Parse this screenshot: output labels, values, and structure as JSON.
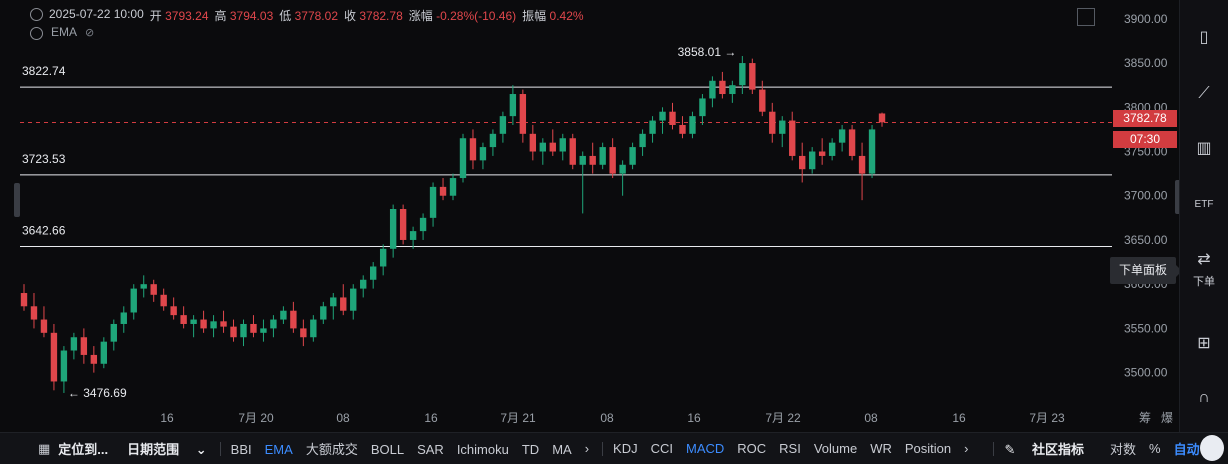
{
  "header": {
    "datetime": "2025-07-22 10:00",
    "open_label": "开",
    "open": "3793.24",
    "high_label": "高",
    "high": "3794.03",
    "low_label": "低",
    "low": "3778.02",
    "close_label": "收",
    "close": "3782.78",
    "change_label": "涨幅",
    "change": "-0.28%(-10.46)",
    "amplitude_label": "振幅",
    "amplitude": "0.42%",
    "indicator": "EMA"
  },
  "levels": [
    {
      "label": "3822.74",
      "value": 3822.74
    },
    {
      "label": "3723.53",
      "value": 3723.53
    },
    {
      "label": "3642.66",
      "value": 3642.66
    }
  ],
  "annotations": {
    "high_mark": "3858.01",
    "low_mark": "3476.69"
  },
  "price_axis": [
    "3900.00",
    "3850.00",
    "3800.00",
    "3750.00",
    "3700.00",
    "3650.00",
    "3600.00",
    "3550.00",
    "3500.00"
  ],
  "current_price": "3782.78",
  "countdown": "07:30",
  "time_axis": [
    "16",
    "7月 20",
    "08",
    "16",
    "7月 21",
    "08",
    "16",
    "7月 22",
    "08",
    "16",
    "7月 23"
  ],
  "time_axis_right": [
    "筹",
    "爆"
  ],
  "order_panel": "下单面板",
  "order_label": "下单",
  "bottom": {
    "goto": "定位到...",
    "date_range": "日期范围",
    "indicators_main": [
      "BBI",
      "EMA",
      "大额成交",
      "BOLL",
      "SAR",
      "Ichimoku",
      "TD",
      "MA"
    ],
    "indicators_sub": [
      "KDJ",
      "CCI",
      "MACD",
      "ROC",
      "RSI",
      "Volume",
      "WR",
      "Position"
    ],
    "community": "社区指标",
    "log": "对数",
    "percent": "%",
    "auto": "自动"
  },
  "colors": {
    "up": "#1fa67a",
    "down": "#e0474c",
    "accent": "#3c8cff",
    "price_tag": "#d23c40"
  },
  "chart_data": {
    "type": "candlestick",
    "ylim": [
      3460,
      3910
    ],
    "candles": [
      {
        "o": 3590,
        "h": 3600,
        "l": 3570,
        "c": 3575
      },
      {
        "o": 3575,
        "h": 3590,
        "l": 3550,
        "c": 3560
      },
      {
        "o": 3560,
        "h": 3575,
        "l": 3540,
        "c": 3545
      },
      {
        "o": 3545,
        "h": 3555,
        "l": 3480,
        "c": 3490
      },
      {
        "o": 3490,
        "h": 3530,
        "l": 3477,
        "c": 3525
      },
      {
        "o": 3525,
        "h": 3545,
        "l": 3515,
        "c": 3540
      },
      {
        "o": 3540,
        "h": 3550,
        "l": 3510,
        "c": 3520
      },
      {
        "o": 3520,
        "h": 3530,
        "l": 3500,
        "c": 3510
      },
      {
        "o": 3510,
        "h": 3540,
        "l": 3505,
        "c": 3535
      },
      {
        "o": 3535,
        "h": 3560,
        "l": 3525,
        "c": 3555
      },
      {
        "o": 3555,
        "h": 3575,
        "l": 3545,
        "c": 3568
      },
      {
        "o": 3568,
        "h": 3600,
        "l": 3560,
        "c": 3595
      },
      {
        "o": 3595,
        "h": 3610,
        "l": 3585,
        "c": 3600
      },
      {
        "o": 3600,
        "h": 3605,
        "l": 3580,
        "c": 3588
      },
      {
        "o": 3588,
        "h": 3595,
        "l": 3570,
        "c": 3575
      },
      {
        "o": 3575,
        "h": 3585,
        "l": 3560,
        "c": 3565
      },
      {
        "o": 3565,
        "h": 3575,
        "l": 3550,
        "c": 3555
      },
      {
        "o": 3555,
        "h": 3565,
        "l": 3540,
        "c": 3560
      },
      {
        "o": 3560,
        "h": 3570,
        "l": 3545,
        "c": 3550
      },
      {
        "o": 3550,
        "h": 3565,
        "l": 3540,
        "c": 3558
      },
      {
        "o": 3558,
        "h": 3570,
        "l": 3545,
        "c": 3552
      },
      {
        "o": 3552,
        "h": 3560,
        "l": 3535,
        "c": 3540
      },
      {
        "o": 3540,
        "h": 3560,
        "l": 3530,
        "c": 3555
      },
      {
        "o": 3555,
        "h": 3565,
        "l": 3540,
        "c": 3545
      },
      {
        "o": 3545,
        "h": 3560,
        "l": 3535,
        "c": 3550
      },
      {
        "o": 3550,
        "h": 3565,
        "l": 3540,
        "c": 3560
      },
      {
        "o": 3560,
        "h": 3575,
        "l": 3555,
        "c": 3570
      },
      {
        "o": 3570,
        "h": 3580,
        "l": 3545,
        "c": 3550
      },
      {
        "o": 3550,
        "h": 3560,
        "l": 3530,
        "c": 3540
      },
      {
        "o": 3540,
        "h": 3565,
        "l": 3535,
        "c": 3560
      },
      {
        "o": 3560,
        "h": 3580,
        "l": 3555,
        "c": 3575
      },
      {
        "o": 3575,
        "h": 3590,
        "l": 3560,
        "c": 3585
      },
      {
        "o": 3585,
        "h": 3600,
        "l": 3565,
        "c": 3570
      },
      {
        "o": 3570,
        "h": 3600,
        "l": 3560,
        "c": 3595
      },
      {
        "o": 3595,
        "h": 3610,
        "l": 3585,
        "c": 3605
      },
      {
        "o": 3605,
        "h": 3625,
        "l": 3595,
        "c": 3620
      },
      {
        "o": 3620,
        "h": 3645,
        "l": 3610,
        "c": 3640
      },
      {
        "o": 3640,
        "h": 3690,
        "l": 3630,
        "c": 3685
      },
      {
        "o": 3685,
        "h": 3690,
        "l": 3645,
        "c": 3650
      },
      {
        "o": 3650,
        "h": 3665,
        "l": 3640,
        "c": 3660
      },
      {
        "o": 3660,
        "h": 3680,
        "l": 3650,
        "c": 3675
      },
      {
        "o": 3675,
        "h": 3715,
        "l": 3665,
        "c": 3710
      },
      {
        "o": 3710,
        "h": 3720,
        "l": 3695,
        "c": 3700
      },
      {
        "o": 3700,
        "h": 3725,
        "l": 3695,
        "c": 3720
      },
      {
        "o": 3720,
        "h": 3770,
        "l": 3715,
        "c": 3765
      },
      {
        "o": 3765,
        "h": 3775,
        "l": 3730,
        "c": 3740
      },
      {
        "o": 3740,
        "h": 3760,
        "l": 3730,
        "c": 3755
      },
      {
        "o": 3755,
        "h": 3775,
        "l": 3745,
        "c": 3770
      },
      {
        "o": 3770,
        "h": 3795,
        "l": 3760,
        "c": 3790
      },
      {
        "o": 3790,
        "h": 3825,
        "l": 3780,
        "c": 3815
      },
      {
        "o": 3815,
        "h": 3820,
        "l": 3760,
        "c": 3770
      },
      {
        "o": 3770,
        "h": 3780,
        "l": 3740,
        "c": 3750
      },
      {
        "o": 3750,
        "h": 3765,
        "l": 3735,
        "c": 3760
      },
      {
        "o": 3760,
        "h": 3775,
        "l": 3745,
        "c": 3750
      },
      {
        "o": 3750,
        "h": 3770,
        "l": 3740,
        "c": 3765
      },
      {
        "o": 3765,
        "h": 3770,
        "l": 3730,
        "c": 3735
      },
      {
        "o": 3735,
        "h": 3750,
        "l": 3680,
        "c": 3745
      },
      {
        "o": 3745,
        "h": 3760,
        "l": 3725,
        "c": 3735
      },
      {
        "o": 3735,
        "h": 3760,
        "l": 3730,
        "c": 3755
      },
      {
        "o": 3755,
        "h": 3765,
        "l": 3720,
        "c": 3725
      },
      {
        "o": 3725,
        "h": 3740,
        "l": 3700,
        "c": 3735
      },
      {
        "o": 3735,
        "h": 3760,
        "l": 3730,
        "c": 3755
      },
      {
        "o": 3755,
        "h": 3775,
        "l": 3745,
        "c": 3770
      },
      {
        "o": 3770,
        "h": 3790,
        "l": 3760,
        "c": 3785
      },
      {
        "o": 3785,
        "h": 3800,
        "l": 3770,
        "c": 3795
      },
      {
        "o": 3795,
        "h": 3805,
        "l": 3775,
        "c": 3780
      },
      {
        "o": 3780,
        "h": 3790,
        "l": 3765,
        "c": 3770
      },
      {
        "o": 3770,
        "h": 3795,
        "l": 3765,
        "c": 3790
      },
      {
        "o": 3790,
        "h": 3815,
        "l": 3780,
        "c": 3810
      },
      {
        "o": 3810,
        "h": 3835,
        "l": 3800,
        "c": 3830
      },
      {
        "o": 3830,
        "h": 3840,
        "l": 3810,
        "c": 3815
      },
      {
        "o": 3815,
        "h": 3830,
        "l": 3805,
        "c": 3825
      },
      {
        "o": 3825,
        "h": 3858,
        "l": 3815,
        "c": 3850
      },
      {
        "o": 3850,
        "h": 3855,
        "l": 3815,
        "c": 3820
      },
      {
        "o": 3820,
        "h": 3830,
        "l": 3790,
        "c": 3795
      },
      {
        "o": 3795,
        "h": 3805,
        "l": 3760,
        "c": 3770
      },
      {
        "o": 3770,
        "h": 3790,
        "l": 3755,
        "c": 3785
      },
      {
        "o": 3785,
        "h": 3795,
        "l": 3740,
        "c": 3745
      },
      {
        "o": 3745,
        "h": 3760,
        "l": 3715,
        "c": 3730
      },
      {
        "o": 3730,
        "h": 3755,
        "l": 3725,
        "c": 3750
      },
      {
        "o": 3750,
        "h": 3765,
        "l": 3735,
        "c": 3745
      },
      {
        "o": 3745,
        "h": 3765,
        "l": 3740,
        "c": 3760
      },
      {
        "o": 3760,
        "h": 3780,
        "l": 3750,
        "c": 3775
      },
      {
        "o": 3775,
        "h": 3780,
        "l": 3740,
        "c": 3745
      },
      {
        "o": 3745,
        "h": 3760,
        "l": 3695,
        "c": 3725
      },
      {
        "o": 3725,
        "h": 3780,
        "l": 3720,
        "c": 3775
      },
      {
        "o": 3793,
        "h": 3794,
        "l": 3778,
        "c": 3783
      }
    ]
  }
}
